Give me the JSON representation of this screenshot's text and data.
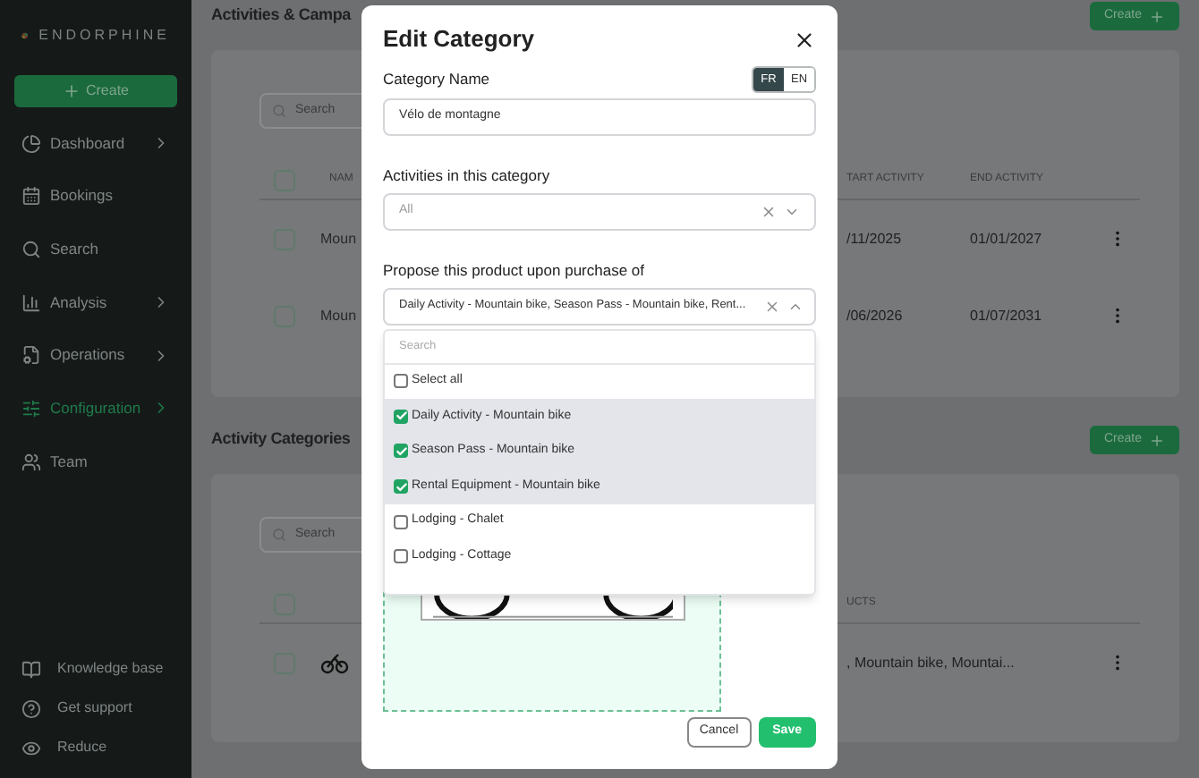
{
  "sidebar": {
    "brand": "ENDORPHINE",
    "create_button": "Create",
    "items": [
      {
        "label": "Dashboard",
        "has_submenu": true,
        "selected": false
      },
      {
        "label": "Bookings",
        "has_submenu": false,
        "selected": false
      },
      {
        "label": "Search",
        "has_submenu": false,
        "selected": false
      },
      {
        "label": "Analysis",
        "has_submenu": true,
        "selected": false
      },
      {
        "label": "Operations",
        "has_submenu": true,
        "selected": false
      },
      {
        "label": "Configuration",
        "has_submenu": true,
        "selected": true
      },
      {
        "label": "Team",
        "has_submenu": false,
        "selected": false
      }
    ],
    "footer_items": [
      {
        "label": "Knowledge base"
      },
      {
        "label": "Get support"
      },
      {
        "label": "Reduce"
      }
    ]
  },
  "sections": [
    {
      "title": "Activities & Campa",
      "create_button": "Create",
      "search": {
        "placeholder": "Search"
      },
      "header_checked": false,
      "column_left": "NAM",
      "columns_right": [
        "TART ACTIVITY",
        "END ACTIVITY"
      ],
      "rows": [
        {
          "checked": false,
          "name": "Moun",
          "thumbnail": false,
          "cells": [
            "/11/2025",
            "01/01/2027"
          ]
        },
        {
          "checked": false,
          "name": "Moun",
          "thumbnail": false,
          "cells": [
            "/06/2026",
            "01/07/2031"
          ]
        }
      ]
    },
    {
      "title": "Activity Categories",
      "create_button": "Create",
      "search": {
        "placeholder": "Search"
      },
      "header_checked": false,
      "columns_right": [
        "UCTS"
      ],
      "rows": [
        {
          "checked": false,
          "thumbnail": true,
          "cells": [
            ", Mountain bike, Mountai..."
          ]
        }
      ]
    }
  ],
  "dialog": {
    "title": "Edit Category",
    "name_label": "Category Name",
    "languages": [
      {
        "label": "FR",
        "selected": true
      },
      {
        "label": "EN",
        "selected": false
      }
    ],
    "name_value": "Vélo de montagne",
    "activities_label": "Activities in this category",
    "activities_placeholder": "All",
    "propose_label": "Propose this product upon purchase of",
    "propose_value": "Daily Activity - Mountain bike, Season Pass - Mountain bike, Rent...",
    "dropdown": {
      "search_placeholder": "Search",
      "options": [
        {
          "label": "Select all",
          "checked": false
        },
        {
          "label": "Daily Activity - Mountain bike",
          "checked": true
        },
        {
          "label": "Season Pass - Mountain bike",
          "checked": true
        },
        {
          "label": "Rental Equipment - Mountain bike",
          "checked": true
        },
        {
          "label": "Lodging - Chalet",
          "checked": false
        },
        {
          "label": "Lodging - Cottage",
          "checked": false
        }
      ]
    },
    "buttons": {
      "cancel": "Cancel",
      "save": "Save"
    }
  }
}
